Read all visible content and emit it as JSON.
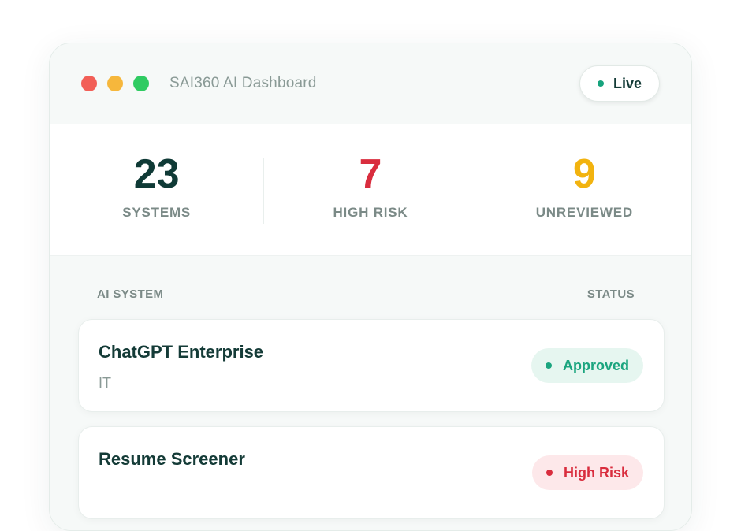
{
  "window": {
    "title": "SAI360 AI Dashboard",
    "controls": {
      "close_color": "#f25f57",
      "minimize_color": "#f6b73c",
      "maximize_color": "#2fcb62"
    },
    "live_badge": {
      "label": "Live",
      "dot_color": "#16a37d"
    }
  },
  "stats": [
    {
      "value": "23",
      "label": "SYSTEMS",
      "color": "#0f3a36"
    },
    {
      "value": "7",
      "label": "HIGH RISK",
      "color": "#d92d3e"
    },
    {
      "value": "9",
      "label": "UNREVIEWED",
      "color": "#f2b30f"
    }
  ],
  "table": {
    "columns": {
      "system": "AI SYSTEM",
      "status": "STATUS"
    },
    "rows": [
      {
        "name": "ChatGPT Enterprise",
        "department": "IT",
        "status": "Approved",
        "status_color": "#1ba57f",
        "status_bg": "#e6f6f0"
      },
      {
        "name": "Resume Screener",
        "department": "",
        "status": "High Risk",
        "status_color": "#d92d3e",
        "status_bg": "#fde8ea"
      }
    ]
  }
}
